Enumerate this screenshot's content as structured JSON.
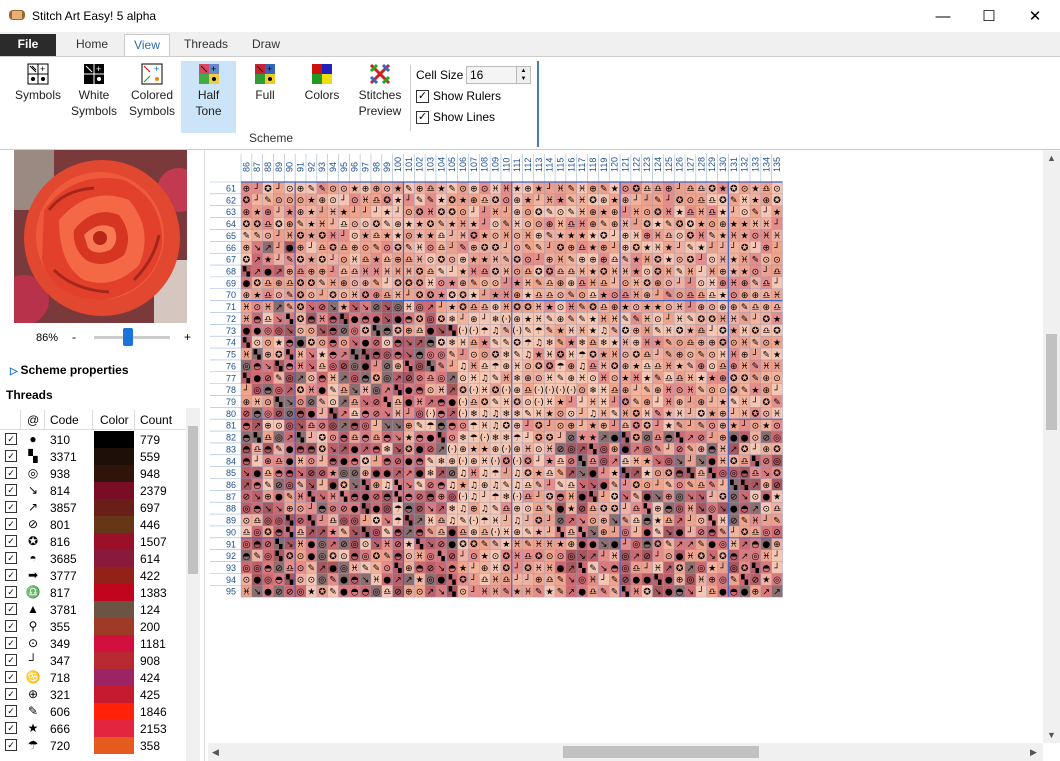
{
  "window": {
    "title": "Stitch Art Easy! 5 alpha",
    "minimize": "—",
    "maximize": "☐",
    "close": "✕"
  },
  "tabs": [
    "File",
    "Home",
    "View",
    "Threads",
    "Draw"
  ],
  "ribbon": {
    "buttons": [
      {
        "l1": "Symbols",
        "l2": "",
        "icon": "symbols-icon"
      },
      {
        "l1": "White",
        "l2": "Symbols",
        "icon": "white-symbols-icon"
      },
      {
        "l1": "Colored",
        "l2": "Symbols",
        "icon": "colored-symbols-icon"
      },
      {
        "l1": "Half",
        "l2": "Tone",
        "icon": "half-tone-icon"
      },
      {
        "l1": "Full",
        "l2": "",
        "icon": "full-icon"
      },
      {
        "l1": "Colors",
        "l2": "",
        "icon": "colors-icon"
      },
      {
        "l1": "Stitches",
        "l2": "Preview",
        "icon": "stitches-preview-icon"
      }
    ],
    "group_label": "Scheme",
    "cell_size_label": "Cell Size",
    "cell_size_value": "16",
    "show_rulers": "Show Rulers",
    "show_lines": "Show Lines"
  },
  "left": {
    "zoom": "86%",
    "minus": "-",
    "plus": "+",
    "scheme_properties": "Scheme properties",
    "threads_title": "Threads",
    "headers": {
      "sym": "@",
      "code": "Code",
      "color": "Color",
      "count": "Count"
    }
  },
  "threads": [
    {
      "sym": "●",
      "code": "310",
      "color": "#000000",
      "count": "779"
    },
    {
      "sym": "▚",
      "code": "3371",
      "color": "#1e1008",
      "count": "559"
    },
    {
      "sym": "◎",
      "code": "938",
      "color": "#2e1409",
      "count": "948"
    },
    {
      "sym": "↘",
      "code": "814",
      "color": "#7a0d26",
      "count": "2379"
    },
    {
      "sym": "↗",
      "code": "3857",
      "color": "#6a1e18",
      "count": "697"
    },
    {
      "sym": "⊘",
      "code": "801",
      "color": "#673617",
      "count": "446"
    },
    {
      "sym": "✪",
      "code": "816",
      "color": "#9a1028",
      "count": "1507"
    },
    {
      "sym": "◓",
      "code": "3685",
      "color": "#8a1a3c",
      "count": "614"
    },
    {
      "sym": "➡",
      "code": "3777",
      "color": "#922118",
      "count": "422"
    },
    {
      "sym": "♎",
      "code": "817",
      "color": "#c2051f",
      "count": "1383"
    },
    {
      "sym": "▲",
      "code": "3781",
      "color": "#6b5443",
      "count": "124"
    },
    {
      "sym": "⚲",
      "code": "355",
      "color": "#9e3a26",
      "count": "200"
    },
    {
      "sym": "⊙",
      "code": "349",
      "color": "#d2103d",
      "count": "1181"
    },
    {
      "sym": "┘",
      "code": "347",
      "color": "#b82a32",
      "count": "908"
    },
    {
      "sym": "♋",
      "code": "718",
      "color": "#9c2465",
      "count": "424"
    },
    {
      "sym": "⊕",
      "code": "321",
      "color": "#c61a30",
      "count": "425"
    },
    {
      "sym": "✎",
      "code": "606",
      "color": "#ff2208",
      "count": "1846"
    },
    {
      "sym": "★",
      "code": "666",
      "color": "#e3253f",
      "count": "2153"
    },
    {
      "sym": "☂",
      "code": "720",
      "color": "#e55a1d",
      "count": "358"
    }
  ],
  "grid": {
    "col_start": 86,
    "col_end": 135,
    "row_start": 61,
    "row_end": 95
  }
}
